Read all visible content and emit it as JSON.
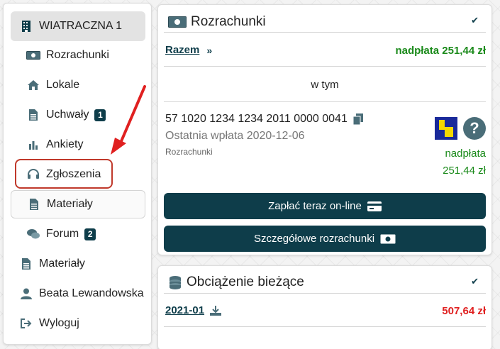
{
  "sidebar": {
    "header": {
      "label": "WIATRACZNA 1",
      "icon": "building-icon"
    },
    "items": [
      {
        "label": "Rozrachunki",
        "icon": "money-icon"
      },
      {
        "label": "Lokale",
        "icon": "home-icon"
      },
      {
        "label": "Uchwały",
        "icon": "document-icon",
        "badge": "1"
      },
      {
        "label": "Ankiety",
        "icon": "bar-chart-icon"
      },
      {
        "label": "Zgłoszenia",
        "icon": "headset-icon"
      },
      {
        "label": "Materiały",
        "icon": "document-icon"
      },
      {
        "label": "Forum",
        "icon": "chat-icon",
        "badge": "2"
      }
    ],
    "bottom_items": [
      {
        "label": "Materiały",
        "icon": "document-icon"
      },
      {
        "label": "Beata Lewandowska",
        "icon": "user-icon"
      },
      {
        "label": "Wyloguj",
        "icon": "logout-icon"
      }
    ]
  },
  "rozrachunki": {
    "title": "Rozrachunki",
    "razem_label": "Razem",
    "razem_value": "nadpłata 251,44 zł",
    "w_tym": "w tym",
    "account_number": "57 1020 1234 1234 2011 0000 0041",
    "last_payment": "Ostatnia wpłata 2020-12-06",
    "account_type": "Rozrachunki",
    "status_line1": "nadpłata",
    "status_line2": "251,44 zł",
    "pay_button": "Zapłać teraz on-line",
    "details_button": "Szczegółowe rozrachunki"
  },
  "obciazenie": {
    "title": "Obciążenie bieżące",
    "period": "2021-01",
    "amount": "507,64 zł"
  },
  "colors": {
    "accent": "#0e3d4a",
    "positive": "#1a8a1a",
    "negative": "#e02020",
    "highlight": "#c0392b"
  }
}
